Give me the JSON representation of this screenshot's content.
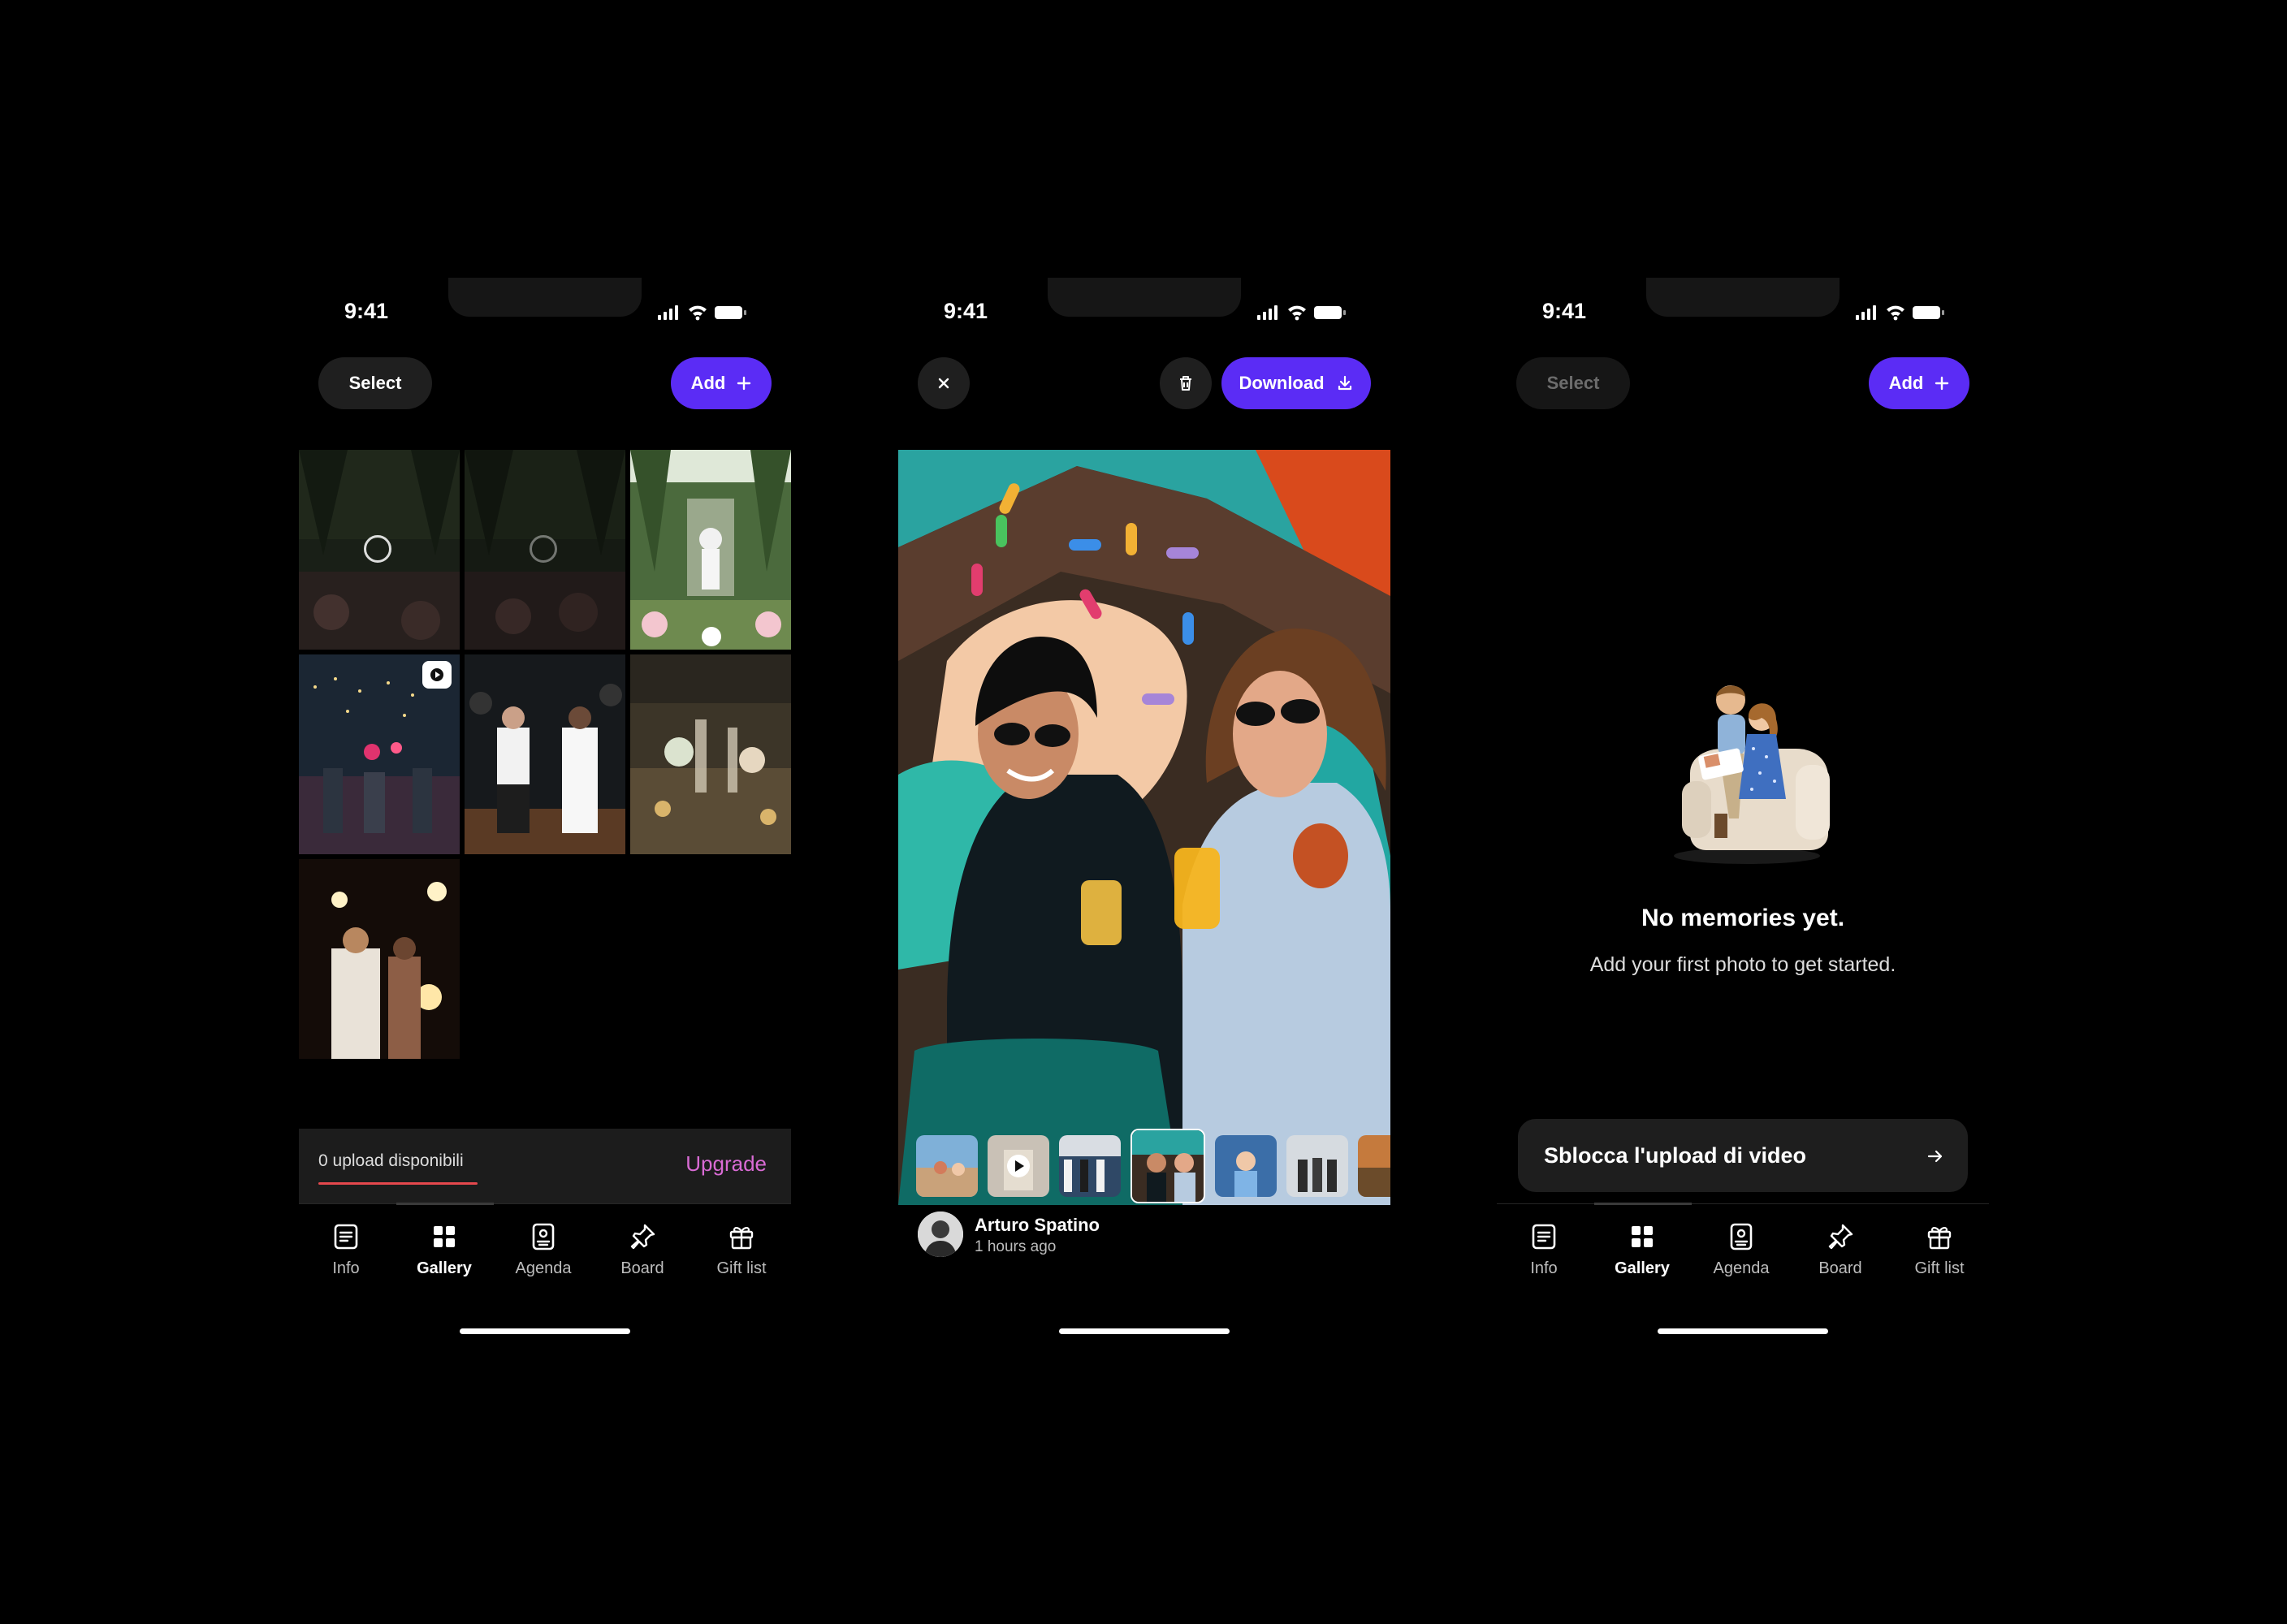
{
  "status": {
    "time": "9:41"
  },
  "gallery": {
    "select_label": "Select",
    "add_label": "Add",
    "upload_status": "0 upload disponibili",
    "upgrade_label": "Upgrade"
  },
  "viewer": {
    "download_label": "Download",
    "author_name": "Arturo Spatino",
    "author_time": "1 hours ago"
  },
  "empty": {
    "select_label": "Select",
    "add_label": "Add",
    "title": "No memories yet.",
    "subtitle": "Add your first photo to get started.",
    "cta_label": "Sblocca l'upload di video"
  },
  "tabs": [
    {
      "label": "Info",
      "icon": "doc-icon"
    },
    {
      "label": "Gallery",
      "icon": "grid-icon"
    },
    {
      "label": "Agenda",
      "icon": "agenda-icon"
    },
    {
      "label": "Board",
      "icon": "pin-icon"
    },
    {
      "label": "Gift list",
      "icon": "gift-icon"
    }
  ],
  "active_tab": "Gallery",
  "colors": {
    "accent": "#5b2cf5",
    "upgrade": "#d96bd4",
    "upload_underline": "#e5484d"
  }
}
